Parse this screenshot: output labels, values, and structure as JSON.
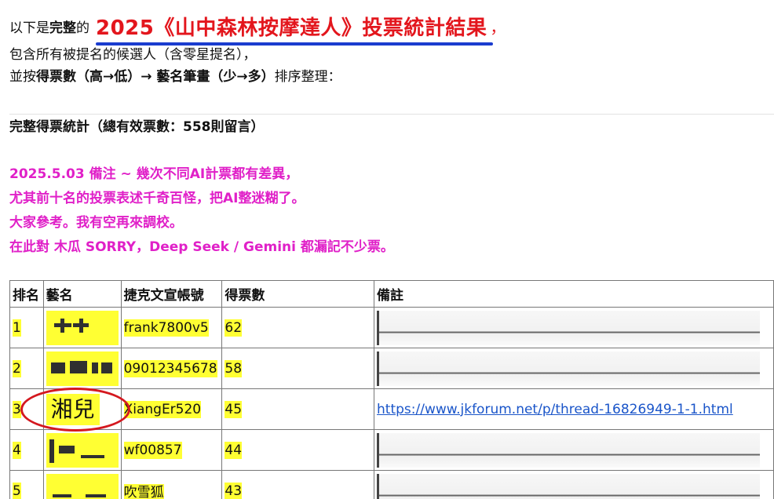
{
  "intro": {
    "prefix": "以下是",
    "bold": "完整",
    "mid": "的",
    "headline": "2025《山中森林按摩達人》投票統計結果",
    "comma": "，",
    "line2": "包含所有被提名的候選人（含零星提名），",
    "line3_a": "並按",
    "line3_b": "得票數（高→低）→ 藝名筆畫（少→多）",
    "line3_c": "排序整理："
  },
  "total": "完整得票統計（總有效票數：558則留言）",
  "note": [
    "2025.5.03 備注 ~ 幾次不同AI計票都有差異，",
    "尤其前十名的投票表述千奇百怪，把AI整迷糊了。",
    "大家參考。我有空再來調校。",
    "在此對 木瓜 SORRY，Deep Seek / Gemini 都漏記不少票。"
  ],
  "colors": {
    "headline": "#e3161d",
    "underline": "#1a3ccf",
    "note": "#e020c8",
    "highlight": "#ffff33",
    "link": "#1a55c9",
    "circle": "#d4181f"
  },
  "table": {
    "headers": [
      "排名",
      "藝名",
      "捷克文宣帳號",
      "得票數",
      "備註"
    ],
    "rows": [
      {
        "rank": "1",
        "name": "",
        "account": "frank7800v5",
        "votes": "62",
        "note": ""
      },
      {
        "rank": "2",
        "name": "",
        "account": "09012345678",
        "votes": "58",
        "note": ""
      },
      {
        "rank": "3",
        "name": "湘兒",
        "account": "XiangEr520",
        "votes": "45",
        "note": "https://www.jkforum.net/p/thread-16826949-1-1.html"
      },
      {
        "rank": "4",
        "name": "",
        "account": "wf00857",
        "votes": "44",
        "note": ""
      },
      {
        "rank": "5",
        "name": "",
        "account": "吹雪狐",
        "votes": "43",
        "note": ""
      }
    ]
  }
}
